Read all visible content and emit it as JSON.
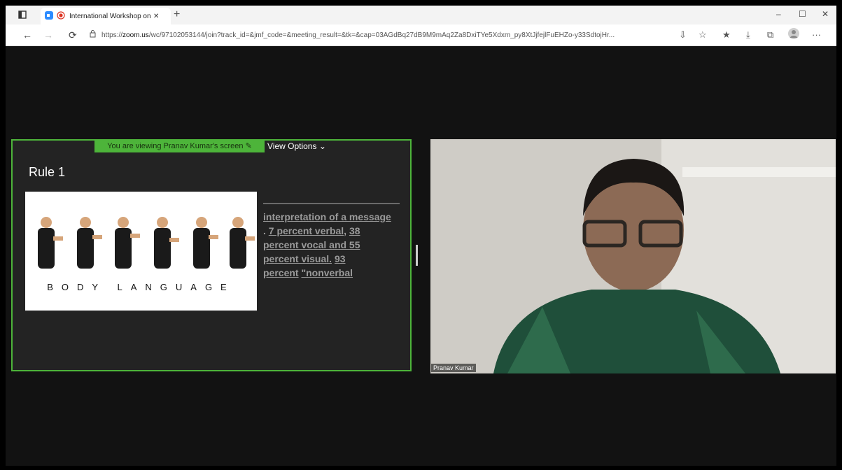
{
  "browser": {
    "tab_title": "International Workshop on",
    "url_prefix": "https://",
    "url_host": "zoom.us",
    "url_rest": "/wc/97102053144/join?track_id=&jmf_code=&meeting_result=&tk=&cap=03AGdBq27dB9M9mAq2Za8DxiTYe5Xdxm_py8XtJjfejlFuEHZo-y33SdtojHr...",
    "new_tab_symbol": "+",
    "minimize_symbol": "–",
    "maximize_symbol": "☐",
    "close_symbol": "✕",
    "more_symbol": "···"
  },
  "share": {
    "banner_text": "You are viewing Pranav Kumar's screen",
    "view_options_label": "View Options",
    "slide_title": "Rule 1",
    "image_caption": "BODY LANGUAGE",
    "text_line1": "interpretation of a message",
    "text_line2_prefix": ". ",
    "text_line2": "7 percent verbal",
    "text_line2_sep": ", ",
    "text_line2b": "38",
    "text_line3": "percent vocal and 55",
    "text_line4": "percent visual.",
    "text_line4b": "93",
    "text_line5a": "percent",
    "text_line5b": "\"nonverbal"
  },
  "video": {
    "participant_name": "Pranav Kumar"
  }
}
